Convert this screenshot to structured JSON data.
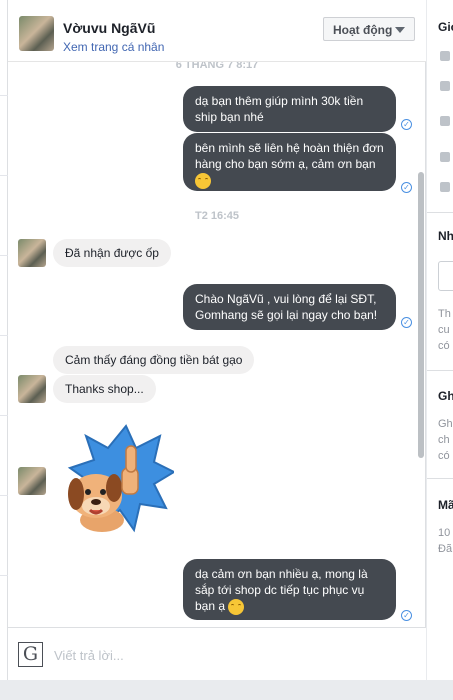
{
  "header": {
    "name": "Vờuvu NgãVũ",
    "profile_link": "Xem trang cá nhân",
    "status_label": "Hoạt động"
  },
  "thread": {
    "timestamp_top": "6 THÁNG 7 8:17",
    "timestamp_mid": "T2 16:45",
    "messages": [
      {
        "from": "shop",
        "text_lines": [
          "dạ bạn thêm giúp mình 30k tiền",
          "ship bạn nhé"
        ]
      },
      {
        "from": "shop",
        "text_lines": [
          "bên mình sẽ liên hệ hoàn thiện đơn",
          "hàng cho bạn sớm ạ, cảm ơn bạn"
        ],
        "emoji": "smiling-face-icon"
      },
      {
        "from": "user",
        "text": "Đã nhận được ốp"
      },
      {
        "from": "shop",
        "text_lines": [
          "Chào NgãVũ , vui lòng để lại SĐT,",
          "Gomhang sẽ gọi lại ngay cho bạn!"
        ]
      },
      {
        "from": "user",
        "text": "Cảm thấy đáng đồng tiền bát gạo"
      },
      {
        "from": "user",
        "text": "Thanks shop..."
      },
      {
        "from": "user",
        "sticker": "thumbs-up-dog-sticker"
      },
      {
        "from": "shop",
        "text_lines": [
          "dạ cảm ơn bạn nhiều ạ, mong là",
          "sắp tới shop dc tiếp tục phục vụ",
          "bạn ạ"
        ],
        "emoji": "smiling-face-icon"
      }
    ]
  },
  "composer": {
    "placeholder": "Viết trả lời...",
    "logo_letter": "G"
  },
  "right_panel": {
    "section1": "Giớ",
    "section2": "Nh",
    "section2_lines": [
      "Th",
      "cu",
      "có"
    ],
    "section3": "Gh",
    "section3_lines": [
      "Gh",
      "ch",
      "có"
    ],
    "section4": "Mã",
    "section4_lines": [
      "10",
      "Đã"
    ]
  },
  "colors": {
    "outgoing_bubble": "#444950",
    "incoming_bubble": "#f1f0f0",
    "link": "#4267b2",
    "seen_check": "#4a90e2"
  }
}
